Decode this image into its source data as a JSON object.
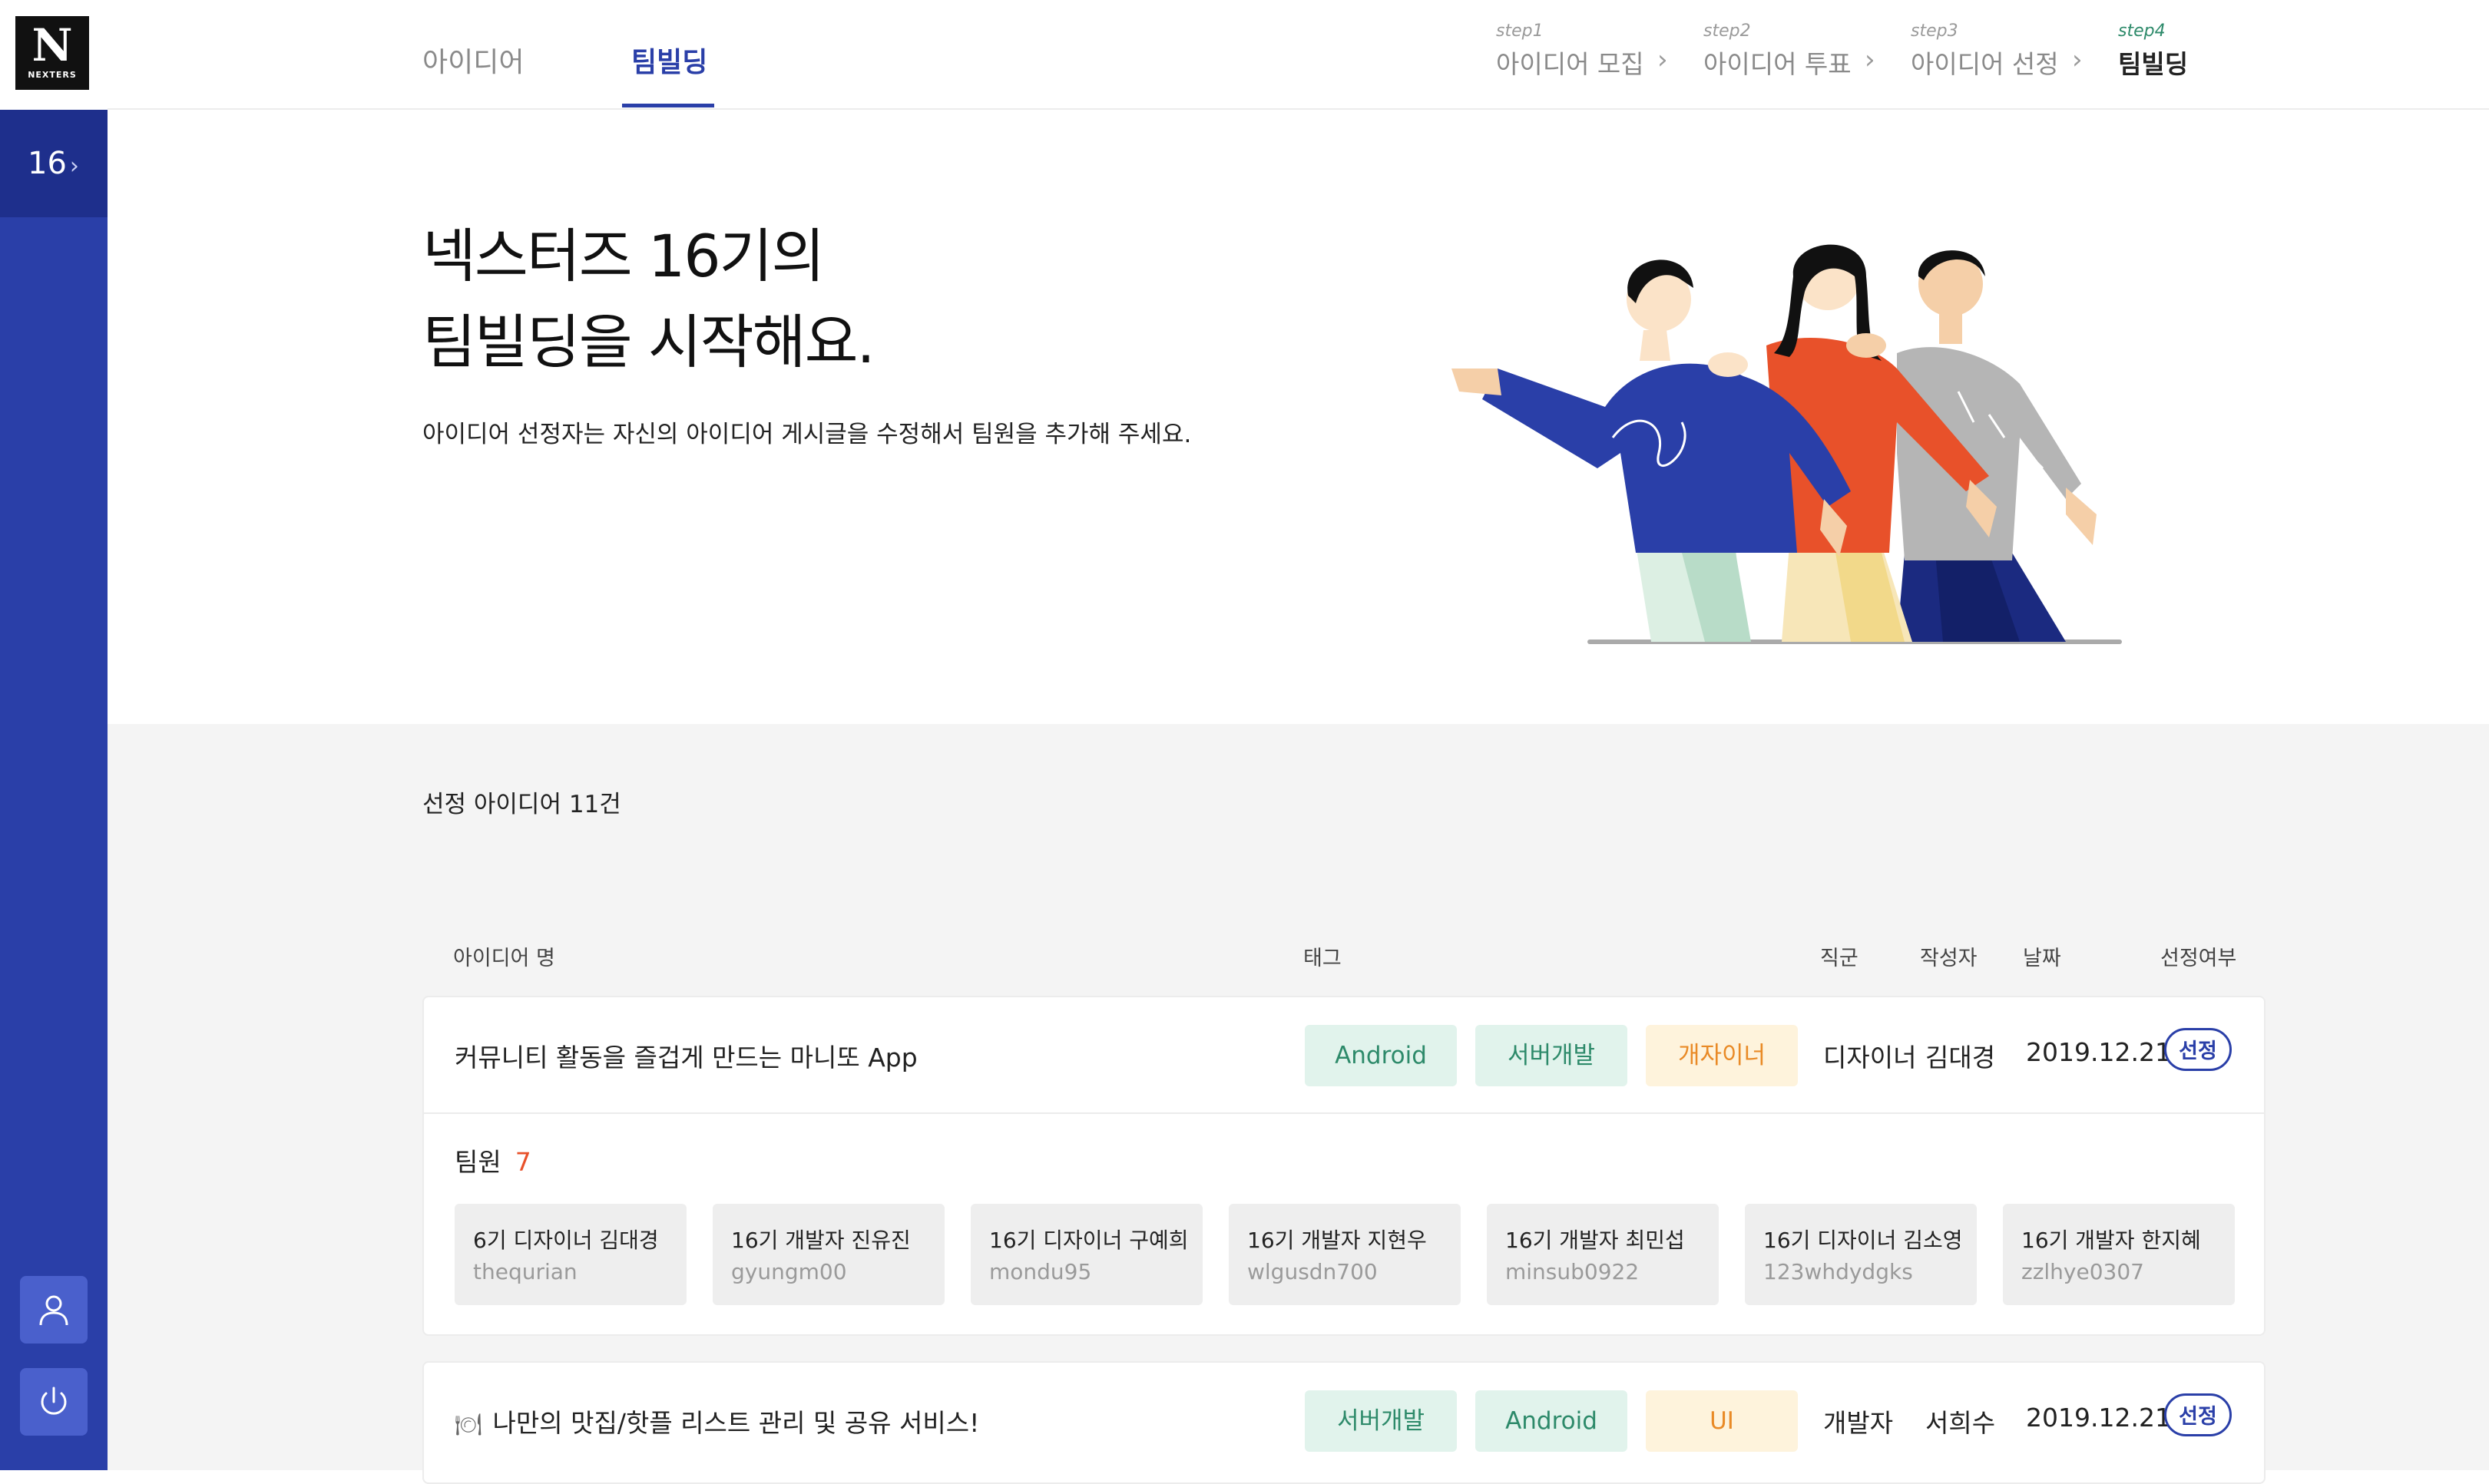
{
  "sidebar": {
    "logo_text": "NEXTERS",
    "generation": "16",
    "generation_chevron": "›"
  },
  "tabs": [
    {
      "label": "아이디어",
      "active": false
    },
    {
      "label": "팀빌딩",
      "active": true
    }
  ],
  "steps": [
    {
      "num": "step1",
      "label": "아이디어 모집",
      "active": false
    },
    {
      "num": "step2",
      "label": "아이디어 투표",
      "active": false
    },
    {
      "num": "step3",
      "label": "아이디어 선정",
      "active": false
    },
    {
      "num": "step4",
      "label": "팀빌딩",
      "active": true
    }
  ],
  "step_separator": "›",
  "hero": {
    "title_line1": "넥스터즈 16기의",
    "title_line2": "팀빌딩을 시작해요.",
    "subtitle": "아이디어 선정자는 자신의 아이디어 게시글을 수정해서 팀원을 추가해 주세요."
  },
  "list": {
    "count_label": "선정 아이디어 11건",
    "columns": {
      "idea": "아이디어 명",
      "tags": "태그",
      "role": "직군",
      "author": "작성자",
      "date": "날짜",
      "selected": "선정여부"
    },
    "items": [
      {
        "title": "커뮤니티 활동을 즐겁게 만드는 마니또 App",
        "tags": [
          "Android",
          "서버개발",
          "개자이너"
        ],
        "role": "디자이너",
        "author": "김대경",
        "date": "2019.12.21",
        "badge": "선정",
        "members_label": "팀원",
        "members_count": "7",
        "members": [
          {
            "name": "6기 디자이너 김대경",
            "id": "thequrian"
          },
          {
            "name": "16기 개발자 진유진",
            "id": "gyungm00"
          },
          {
            "name": "16기 디자이너 구예희",
            "id": "mondu95"
          },
          {
            "name": "16기 개발자 지현우",
            "id": "wlgusdn700"
          },
          {
            "name": "16기 개발자 최민섭",
            "id": "minsub0922"
          },
          {
            "name": "16기 디자이너 김소영",
            "id": "123whdydgks"
          },
          {
            "name": "16기 개발자 한지혜",
            "id": "zzlhye0307"
          }
        ]
      },
      {
        "emoji": "🍽",
        "title": "나만의 맛집/핫플 리스트 관리 및 공유 서비스!",
        "tags": [
          "서버개발",
          "Android",
          "UI"
        ],
        "role": "개발자",
        "author": "서희수",
        "date": "2019.12.21",
        "badge": "선정"
      }
    ]
  },
  "colors": {
    "sidebar": "#2a3fa8",
    "accent": "#2a3fa8",
    "tag_green_bg": "#e1f3ec",
    "tag_green_text": "#2d8a6a",
    "tag_yellow_bg": "#fef3dc",
    "tag_yellow_text": "#e98a26",
    "member_count": "#e8512a"
  },
  "icons": {
    "profile": "user-icon",
    "logout": "power-icon"
  }
}
